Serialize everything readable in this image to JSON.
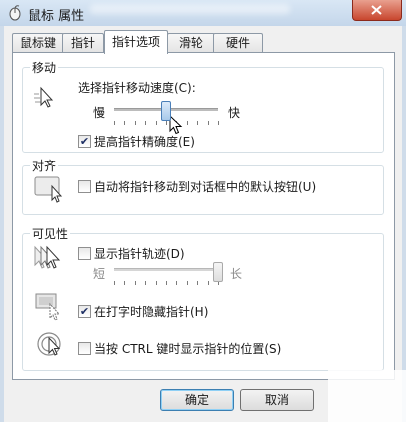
{
  "window": {
    "title": "鼠标 属性"
  },
  "tabs": [
    "鼠标键",
    "指针",
    "指针选项",
    "滑轮",
    "硬件"
  ],
  "active_tab": "指针选项",
  "motion": {
    "group_title": "移动",
    "speed_label": "选择指针移动速度(C):",
    "slow_label": "慢",
    "fast_label": "快",
    "speed_level": 0.5,
    "precision_label": "提高指针精确度(E)",
    "precision_checked": true
  },
  "snap": {
    "group_title": "对齐",
    "snap_label": "自动将指针移动到对话框中的默认按钮(U)",
    "snap_checked": false
  },
  "visibility": {
    "group_title": "可见性",
    "trails_label": "显示指针轨迹(D)",
    "trails_checked": false,
    "short_label": "短",
    "long_label": "长",
    "trails_level": 1.0,
    "hide_label": "在打字时隐藏指针(H)",
    "hide_checked": true,
    "ctrl_label": "当按 CTRL 键时显示指针的位置(S)",
    "ctrl_checked": false
  },
  "buttons": {
    "ok": "确定",
    "cancel": "取消"
  },
  "colors": {
    "titlebar": "#c4d6ea",
    "close_button": "#c8462e",
    "panel_border": "#8d99a6"
  },
  "icons": [
    "mouse-icon",
    "pointer-speed-icon",
    "pointer-snap-icon",
    "pointer-trails-icon",
    "hide-pointer-icon",
    "locate-pointer-icon"
  ]
}
